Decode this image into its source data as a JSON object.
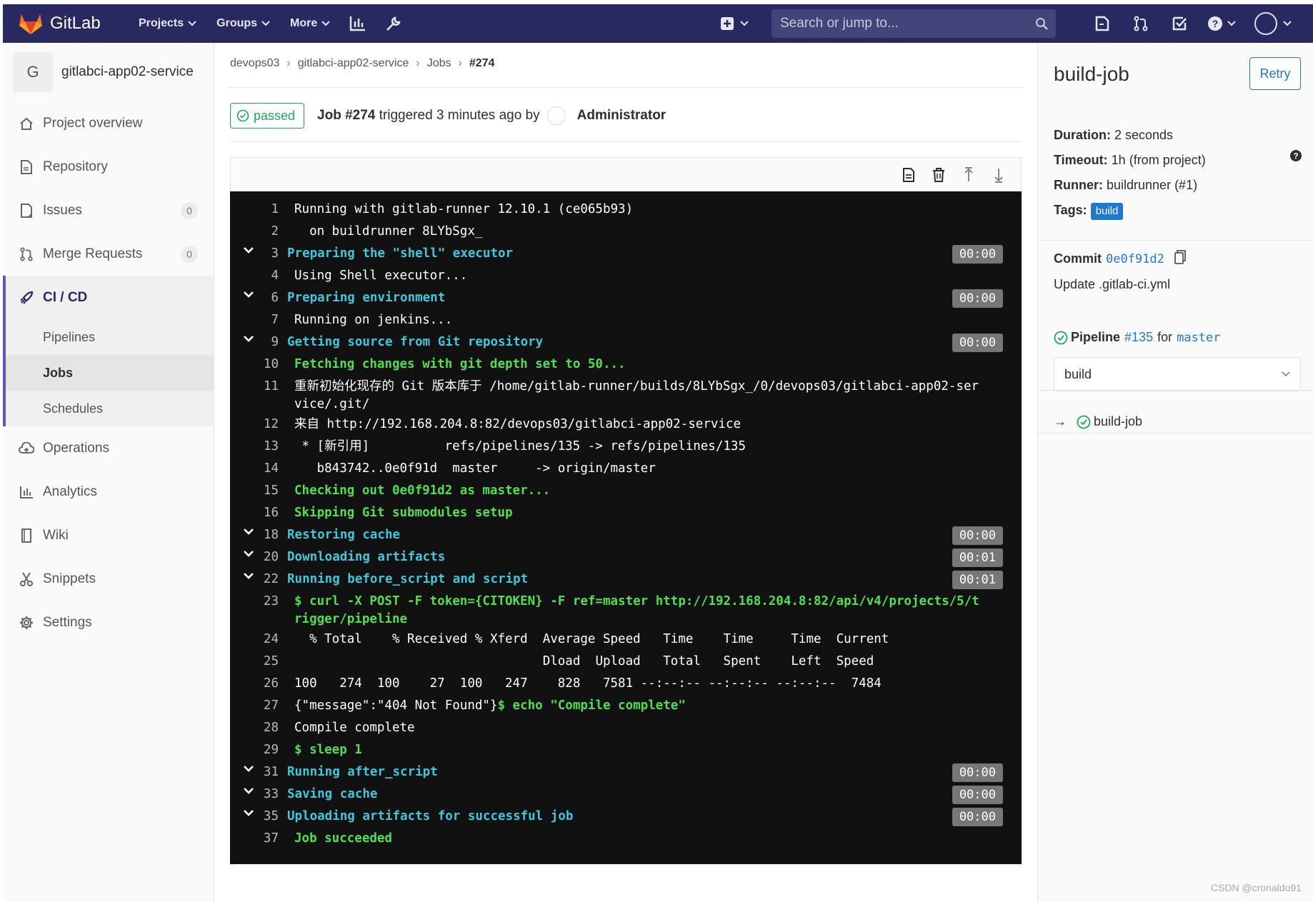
{
  "navbar": {
    "brand": "GitLab",
    "menu": [
      {
        "label": "Projects"
      },
      {
        "label": "Groups"
      },
      {
        "label": "More"
      }
    ],
    "search_placeholder": "Search or jump to..."
  },
  "sidebar": {
    "project_initial": "G",
    "project_name": "gitlabci-app02-service",
    "items_top": [
      {
        "label": "Project overview",
        "icon": "home-icon"
      },
      {
        "label": "Repository",
        "icon": "doc-icon"
      },
      {
        "label": "Issues",
        "icon": "issues-icon",
        "count": "0"
      },
      {
        "label": "Merge Requests",
        "icon": "merge-icon",
        "count": "0"
      }
    ],
    "cicd": {
      "label": "CI / CD",
      "children": [
        "Pipelines",
        "Jobs",
        "Schedules"
      ],
      "active": "Jobs"
    },
    "items_bottom": [
      {
        "label": "Operations",
        "icon": "cloud-icon"
      },
      {
        "label": "Analytics",
        "icon": "chart-icon"
      },
      {
        "label": "Wiki",
        "icon": "book-icon"
      },
      {
        "label": "Snippets",
        "icon": "scissors-icon"
      },
      {
        "label": "Settings",
        "icon": "gear-icon"
      }
    ]
  },
  "breadcrumb": [
    "devops03",
    "gitlabci-app02-service",
    "Jobs",
    "#274"
  ],
  "job": {
    "status": "passed",
    "title_bold": "Job #274",
    "title_rest": " triggered 3 minutes ago by",
    "user": "Administrator"
  },
  "log": [
    {
      "n": "1",
      "text": "Running with gitlab-runner 12.10.1 (ce065b93)",
      "kind": "plain"
    },
    {
      "n": "2",
      "text": "  on buildrunner 8LYbSgx_",
      "kind": "plain"
    },
    {
      "n": "3",
      "text": "Preparing the \"shell\" executor",
      "kind": "section",
      "dur": "00:00"
    },
    {
      "n": "4",
      "text": "Using Shell executor...",
      "kind": "plain"
    },
    {
      "n": "6",
      "text": "Preparing environment",
      "kind": "section",
      "dur": "00:00"
    },
    {
      "n": "7",
      "text": "Running on jenkins...",
      "kind": "plain"
    },
    {
      "n": "9",
      "text": "Getting source from Git repository",
      "kind": "section",
      "dur": "00:00"
    },
    {
      "n": "10",
      "text": "Fetching changes with git depth set to 50...",
      "kind": "green"
    },
    {
      "n": "11",
      "text": "重新初始化现存的 Git 版本库于 /home/gitlab-runner/builds/8LYbSgx_/0/devops03/gitlabci-app02-ser\nvice/.git/",
      "kind": "plain"
    },
    {
      "n": "12",
      "text": "来自 http://192.168.204.8:82/devops03/gitlabci-app02-service",
      "kind": "plain"
    },
    {
      "n": "13",
      "text": " * [新引用]          refs/pipelines/135 -> refs/pipelines/135",
      "kind": "plain"
    },
    {
      "n": "14",
      "text": "   b843742..0e0f91d  master     -> origin/master",
      "kind": "plain"
    },
    {
      "n": "15",
      "text": "Checking out 0e0f91d2 as master...",
      "kind": "green"
    },
    {
      "n": "16",
      "text": "Skipping Git submodules setup",
      "kind": "green"
    },
    {
      "n": "18",
      "text": "Restoring cache",
      "kind": "section",
      "dur": "00:00"
    },
    {
      "n": "20",
      "text": "Downloading artifacts",
      "kind": "section",
      "dur": "00:01"
    },
    {
      "n": "22",
      "text": "Running before_script and script",
      "kind": "section",
      "dur": "00:01"
    },
    {
      "n": "23",
      "text": "$ curl -X POST -F token={CITOKEN} -F ref=master http://192.168.204.8:82/api/v4/projects/5/t\nrigger/pipeline",
      "kind": "green"
    },
    {
      "n": "24",
      "text": "  % Total    % Received % Xferd  Average Speed   Time    Time     Time  Current",
      "kind": "plain"
    },
    {
      "n": "25",
      "text": "                                 Dload  Upload   Total   Spent    Left  Speed",
      "kind": "plain"
    },
    {
      "n": "26",
      "text": "100   274  100    27  100   247    828   7581 --:--:-- --:--:-- --:--:--  7484",
      "kind": "plain"
    },
    {
      "n": "27",
      "text": "{\"message\":\"404 Not Found\"}",
      "green_tail": "$ echo \"Compile complete\"",
      "kind": "mixed"
    },
    {
      "n": "28",
      "text": "Compile complete",
      "kind": "plain"
    },
    {
      "n": "29",
      "text": "$ sleep 1",
      "kind": "green"
    },
    {
      "n": "31",
      "text": "Running after_script",
      "kind": "section",
      "dur": "00:00"
    },
    {
      "n": "33",
      "text": "Saving cache",
      "kind": "section",
      "dur": "00:00"
    },
    {
      "n": "35",
      "text": "Uploading artifacts for successful job",
      "kind": "section",
      "dur": "00:00"
    },
    {
      "n": "37",
      "text": "Job succeeded",
      "kind": "green"
    }
  ],
  "right": {
    "title": "build-job",
    "retry": "Retry",
    "duration_label": "Duration:",
    "duration": " 2 seconds",
    "timeout_label": "Timeout:",
    "timeout": " 1h (from project)",
    "runner_label": "Runner:",
    "runner": " buildrunner (#1)",
    "tags_label": "Tags:",
    "tag": "build",
    "commit_label": "Commit",
    "commit_sha": "0e0f91d2",
    "commit_msg": "Update .gitlab-ci.yml",
    "pipeline_label": "Pipeline",
    "pipeline_id": "#135",
    "pipeline_for": "for",
    "pipeline_ref": "master",
    "stage": "build",
    "job_item": "build-job"
  },
  "watermark": "CSDN @cronaldo91",
  "colors": {
    "navbar": "#292961",
    "success": "#1aaa55",
    "link": "#1f78d1",
    "log_bg": "#111111"
  }
}
